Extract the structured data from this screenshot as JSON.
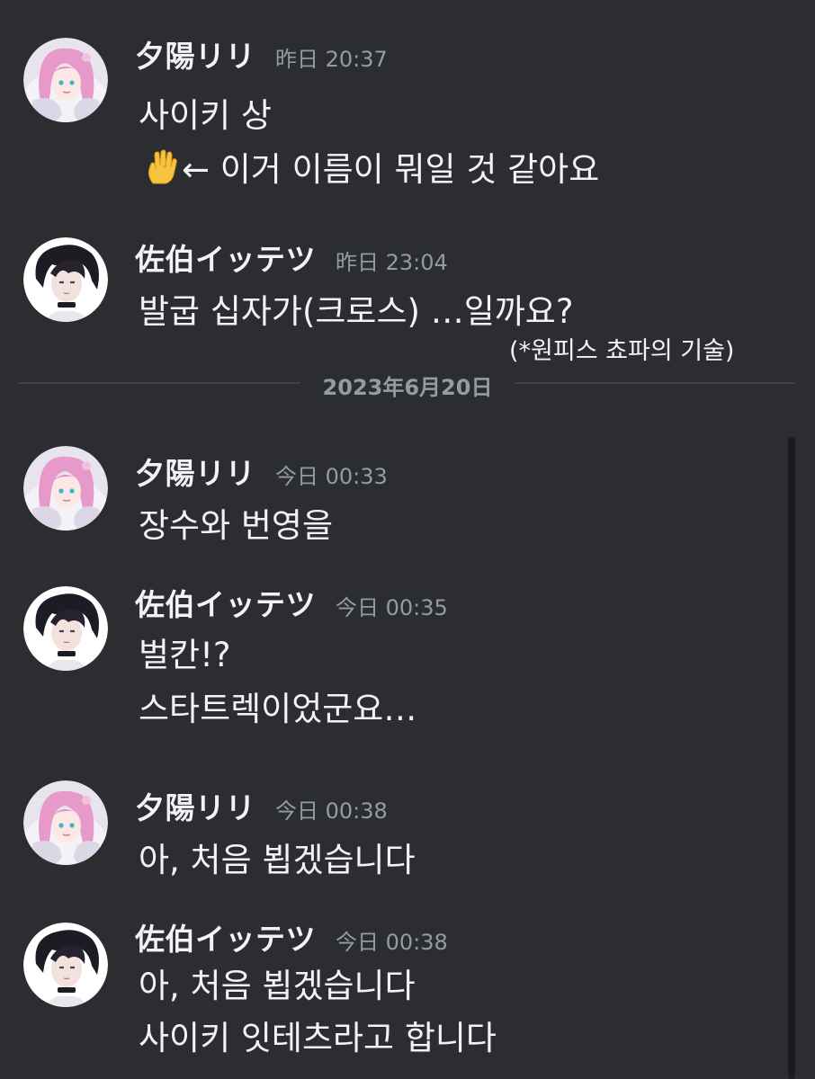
{
  "users": {
    "yuhi": {
      "name": "夕陽リリ",
      "avatar_icon": "pink-hair-avatar"
    },
    "saeki": {
      "name": "佐伯イッテツ",
      "avatar_icon": "dark-hair-avatar"
    }
  },
  "messages": [
    {
      "author": "夕陽リリ",
      "timestamp": "昨日 20:37",
      "lines": [
        "사이키 상",
        "← 이거 이름이 뭐일 것 같아요"
      ],
      "emoji": "vulcan-salute-emoji"
    },
    {
      "author": "佐伯イッテツ",
      "timestamp": "昨日 23:04",
      "lines": [
        "발굽 십자가(크로스) …일까요?"
      ],
      "note": "(*원피스 쵸파의 기술)"
    },
    {
      "author": "夕陽リリ",
      "timestamp": "今日 00:33",
      "lines": [
        "장수와 번영을"
      ]
    },
    {
      "author": "佐伯イッテツ",
      "timestamp": "今日 00:35",
      "lines": [
        "벌칸!?",
        "스타트렉이었군요…"
      ]
    },
    {
      "author": "夕陽リリ",
      "timestamp": "今日 00:38",
      "lines": [
        "아, 처음 뵙겠습니다"
      ]
    },
    {
      "author": "佐伯イッテツ",
      "timestamp": "今日 00:38",
      "lines": [
        "아, 처음 뵙겠습니다",
        "사이키 잇테츠라고 합니다"
      ]
    }
  ],
  "date_divider": "2023年6月20日",
  "colors": {
    "background": "#2b2d31",
    "text": "#f2f3f5",
    "muted": "#949ba4",
    "divider": "#3f4147"
  }
}
